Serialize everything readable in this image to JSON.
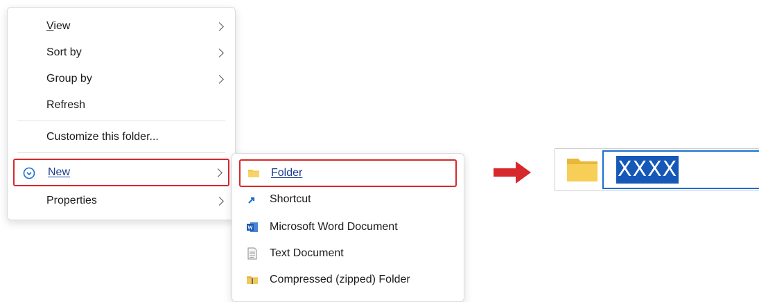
{
  "context_menu": {
    "items": [
      {
        "label": "View",
        "underline_first": true
      },
      {
        "label": "Sort by"
      },
      {
        "label": "Group by"
      },
      {
        "label": "Refresh"
      },
      {
        "label": "Customize this folder..."
      },
      {
        "label": "New"
      },
      {
        "label": "Properties"
      }
    ]
  },
  "new_submenu": {
    "items": [
      {
        "label": "Folder",
        "icon": "folder-icon"
      },
      {
        "label": "Shortcut",
        "icon": "shortcut-icon"
      },
      {
        "label": "Microsoft Word Document",
        "icon": "word-document-icon"
      },
      {
        "label": "Text Document",
        "icon": "text-document-icon"
      },
      {
        "label": "Compressed (zipped) Folder",
        "icon": "zip-folder-icon"
      }
    ]
  },
  "rename": {
    "value": "XXXX"
  },
  "colors": {
    "highlight_border": "#d7282c",
    "selection": "#1658b8",
    "arrow": "#d7282c",
    "folder": "#f4c542"
  }
}
